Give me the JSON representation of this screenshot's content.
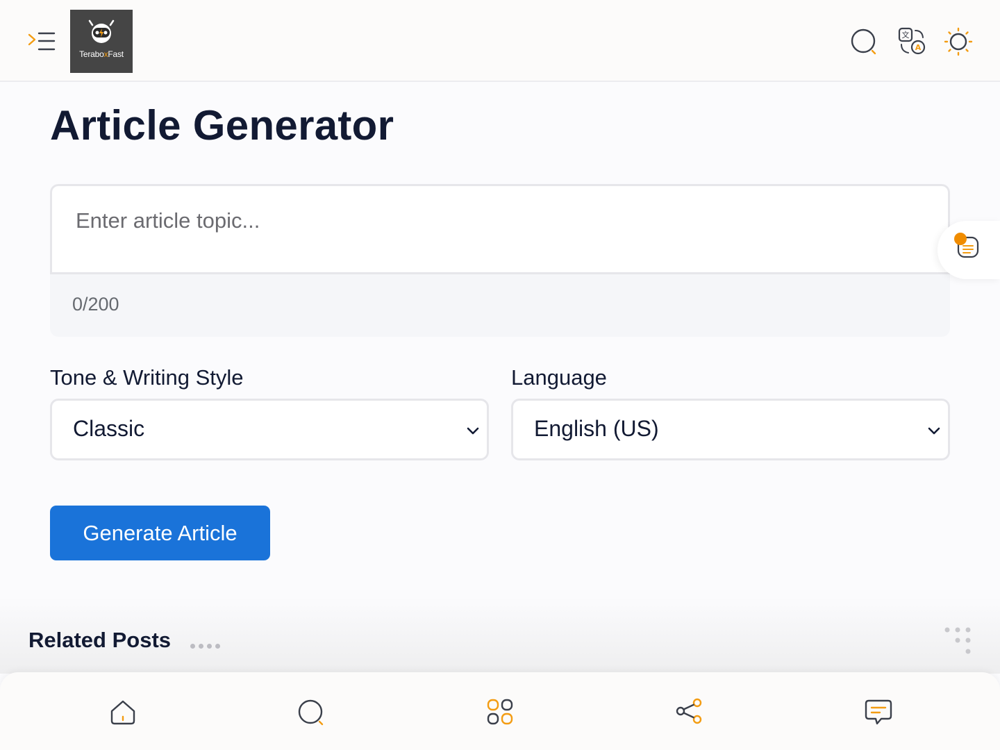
{
  "header": {
    "logo_text_prefix": "Terabo",
    "logo_text_x": "x",
    "logo_text_suffix": "Fast",
    "icons": [
      "menu-icon",
      "search-icon",
      "translate-icon",
      "theme-sun-icon"
    ]
  },
  "page": {
    "title": "Article Generator"
  },
  "topic": {
    "placeholder": "Enter article topic...",
    "counter": "0/200"
  },
  "tone": {
    "label": "Tone & Writing Style",
    "selected": "Classic"
  },
  "language": {
    "label": "Language",
    "selected": "English (US)"
  },
  "generate_button": "Generate Article",
  "related": {
    "title": "Related Posts"
  },
  "bottom_nav": {
    "items": [
      "home-icon",
      "search-icon",
      "apps-icon",
      "share-icon",
      "chat-icon"
    ]
  },
  "colors": {
    "accent": "#f39c12",
    "primary_button": "#1a73d9",
    "text": "#121a33"
  }
}
